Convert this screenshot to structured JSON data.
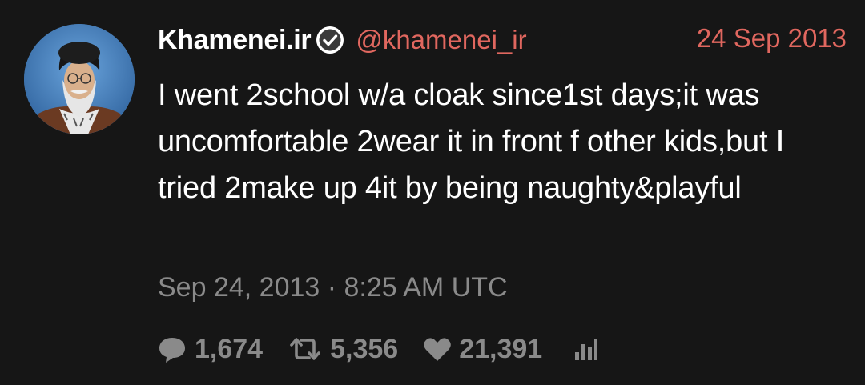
{
  "tweet": {
    "display_name": "Khamenei.ir",
    "handle": "@khamenei_ir",
    "date": "24 Sep 2013",
    "text": "I went 2school w/a cloak since1st days;it was uncomfortable 2wear it in front f other kids,but I tried 2make up 4it by being naughty&playful",
    "timestamp": "Sep 24, 2013 · 8:25 AM UTC",
    "replies": "1,674",
    "retweets": "5,356",
    "likes": "21,391"
  },
  "icons": {
    "avatar": "avatar",
    "verified": "verified-badge-icon",
    "reply": "comment-icon",
    "retweet": "retweet-icon",
    "like": "heart-icon",
    "stats": "stats-icon"
  },
  "colors": {
    "background": "#161616",
    "accent": "#e0675f",
    "muted": "#8a8a8a",
    "text": "#ffffff"
  }
}
